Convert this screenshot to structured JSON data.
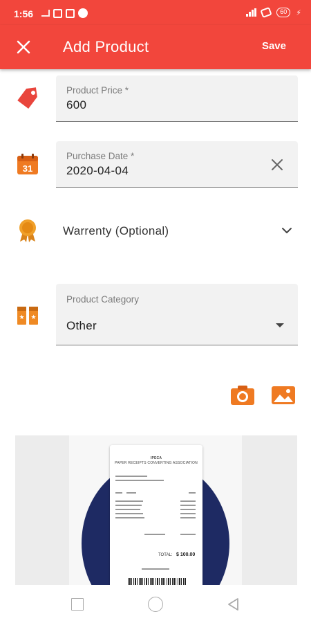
{
  "status_bar": {
    "time": "1:56",
    "battery": "60"
  },
  "app_bar": {
    "title": "Add Product",
    "save_label": "Save"
  },
  "form": {
    "price": {
      "label": "Product Price *",
      "value": "600"
    },
    "purchase_date": {
      "label": "Purchase Date *",
      "value": "2020-04-04"
    },
    "warranty": {
      "label": "Warrenty  (Optional)"
    },
    "category": {
      "label": "Product Category",
      "value": "Other"
    }
  },
  "icons": {
    "price": "price-tag-icon",
    "date": "calendar-icon",
    "warranty": "award-ribbon-icon",
    "category": "category-icon",
    "camera": "camera-icon",
    "gallery": "gallery-icon"
  },
  "receipt": {
    "header_line1": "IPECA",
    "header_line2": "PAPER RECEIPTS CONVERTING ASSOCIATION",
    "total_label": "TOTAL:",
    "total_value": "$ 100.00"
  },
  "colors": {
    "primary": "#f2463c",
    "accent_orange": "#ef8a24",
    "navy": "#1e2a63"
  }
}
